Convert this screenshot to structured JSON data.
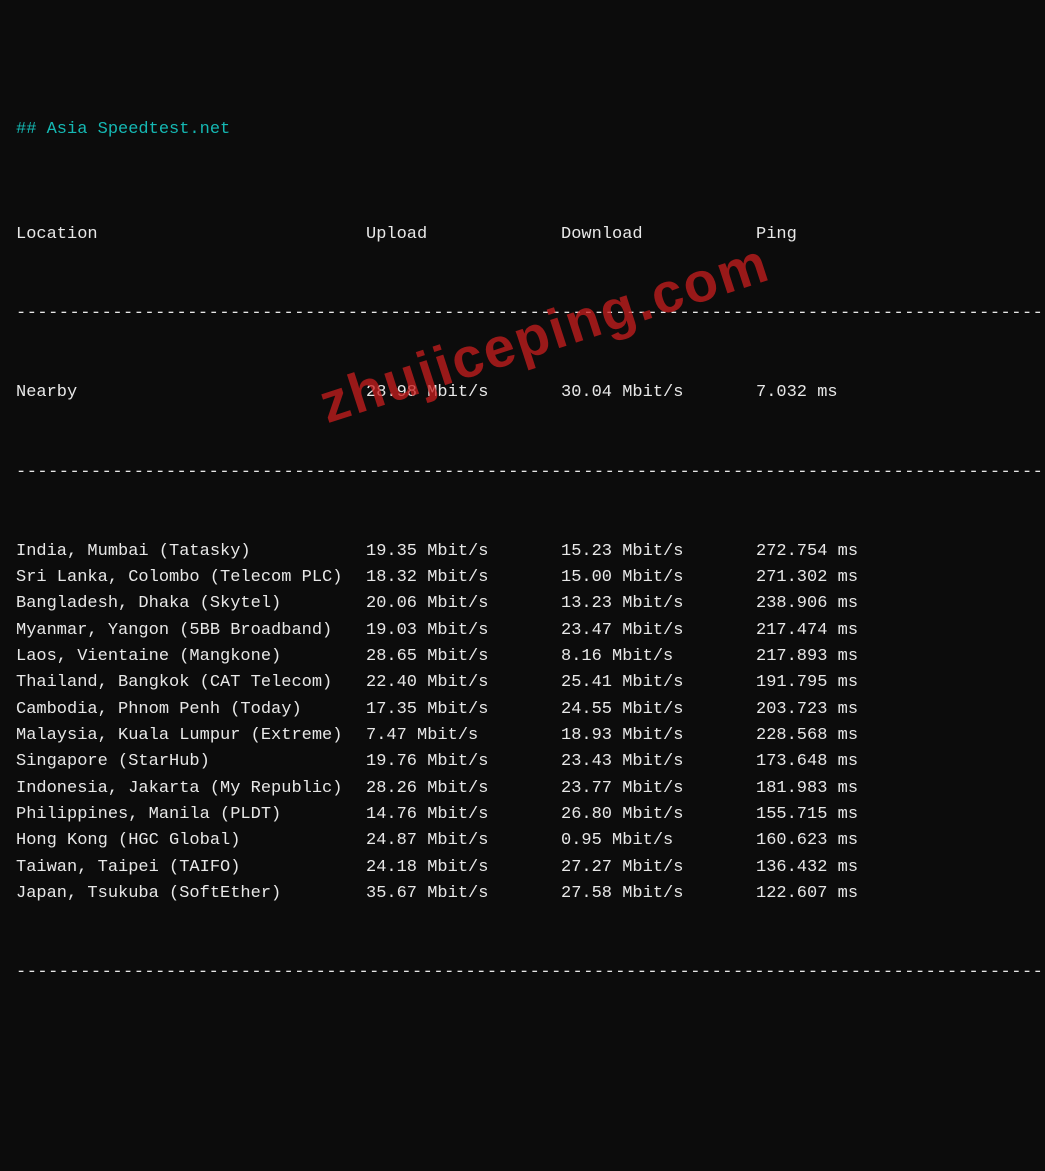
{
  "heading": "## Asia Speedtest.net",
  "headers": {
    "location": "Location",
    "upload": "Upload",
    "download": "Download",
    "ping": "Ping"
  },
  "divider": "--------------------------------------------------------------------------------------------------",
  "nearby": {
    "location": "Nearby",
    "upload": "28.98 Mbit/s",
    "download": "30.04 Mbit/s",
    "ping": "7.032 ms"
  },
  "rows": [
    {
      "location": "India, Mumbai (Tatasky)",
      "upload": "19.35 Mbit/s",
      "download": "15.23 Mbit/s",
      "ping": "272.754 ms"
    },
    {
      "location": "Sri Lanka, Colombo (Telecom PLC)",
      "upload": "18.32 Mbit/s",
      "download": "15.00 Mbit/s",
      "ping": "271.302 ms"
    },
    {
      "location": "Bangladesh, Dhaka (Skytel)",
      "upload": "20.06 Mbit/s",
      "download": "13.23 Mbit/s",
      "ping": "238.906 ms"
    },
    {
      "location": "Myanmar, Yangon (5BB Broadband)",
      "upload": "19.03 Mbit/s",
      "download": "23.47 Mbit/s",
      "ping": "217.474 ms"
    },
    {
      "location": "Laos, Vientaine (Mangkone)",
      "upload": "28.65 Mbit/s",
      "download": "8.16 Mbit/s",
      "ping": "217.893 ms"
    },
    {
      "location": "Thailand, Bangkok (CAT Telecom)",
      "upload": "22.40 Mbit/s",
      "download": "25.41 Mbit/s",
      "ping": "191.795 ms"
    },
    {
      "location": "Cambodia, Phnom Penh (Today)",
      "upload": "17.35 Mbit/s",
      "download": "24.55 Mbit/s",
      "ping": "203.723 ms"
    },
    {
      "location": "Malaysia, Kuala Lumpur (Extreme)",
      "upload": "7.47 Mbit/s",
      "download": "18.93 Mbit/s",
      "ping": "228.568 ms"
    },
    {
      "location": "Singapore (StarHub)",
      "upload": "19.76 Mbit/s",
      "download": "23.43 Mbit/s",
      "ping": "173.648 ms"
    },
    {
      "location": "Indonesia, Jakarta (My Republic)",
      "upload": "28.26 Mbit/s",
      "download": "23.77 Mbit/s",
      "ping": "181.983 ms"
    },
    {
      "location": "Philippines, Manila (PLDT)",
      "upload": "14.76 Mbit/s",
      "download": "26.80 Mbit/s",
      "ping": "155.715 ms"
    },
    {
      "location": "Hong Kong (HGC Global)",
      "upload": "24.87 Mbit/s",
      "download": "0.95 Mbit/s",
      "ping": "160.623 ms"
    },
    {
      "location": "Taiwan, Taipei (TAIFO)",
      "upload": "24.18 Mbit/s",
      "download": "27.27 Mbit/s",
      "ping": "136.432 ms"
    },
    {
      "location": "Japan, Tsukuba (SoftEther)",
      "upload": "35.67 Mbit/s",
      "download": "27.58 Mbit/s",
      "ping": "122.607 ms"
    }
  ],
  "watermark": "zhujiceping.com"
}
